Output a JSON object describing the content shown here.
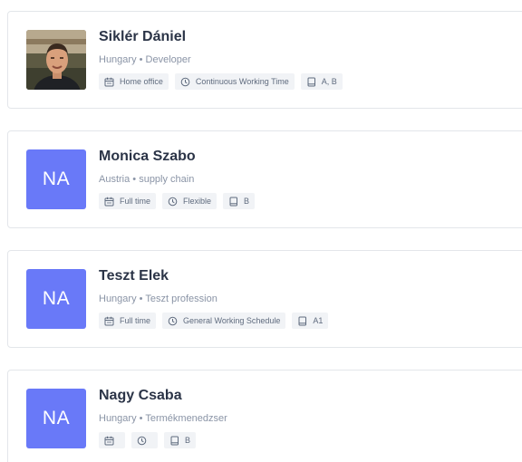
{
  "employees": [
    {
      "name": "Siklér Dániel",
      "subtitle": "Hungary • Developer",
      "avatar": {
        "type": "photo",
        "initials": ""
      },
      "tags": {
        "work_type": "Home office",
        "schedule": "Continuous Working Time",
        "license": "A, B"
      }
    },
    {
      "name": "Monica Szabo",
      "subtitle": "Austria • supply chain",
      "avatar": {
        "type": "initials",
        "initials": "NA"
      },
      "tags": {
        "work_type": "Full time",
        "schedule": "Flexible",
        "license": "B"
      }
    },
    {
      "name": "Teszt Elek",
      "subtitle": "Hungary • Teszt profession",
      "avatar": {
        "type": "initials",
        "initials": "NA"
      },
      "tags": {
        "work_type": "Full time",
        "schedule": "General Working Schedule",
        "license": "A1"
      }
    },
    {
      "name": "Nagy Csaba",
      "subtitle": "Hungary • Termékmenedzser",
      "avatar": {
        "type": "initials",
        "initials": "NA"
      },
      "tags": {
        "work_type": "",
        "schedule": "",
        "license": "B"
      }
    }
  ],
  "icons": {
    "work_type": "calendar-icon",
    "schedule": "clock-icon",
    "license": "book-icon"
  },
  "colors": {
    "avatar_bg": "#6979f8",
    "name_text": "#2b3447",
    "subtitle_text": "#8a94a6",
    "tag_bg": "#f1f3f6",
    "border": "#e3e6ea"
  }
}
